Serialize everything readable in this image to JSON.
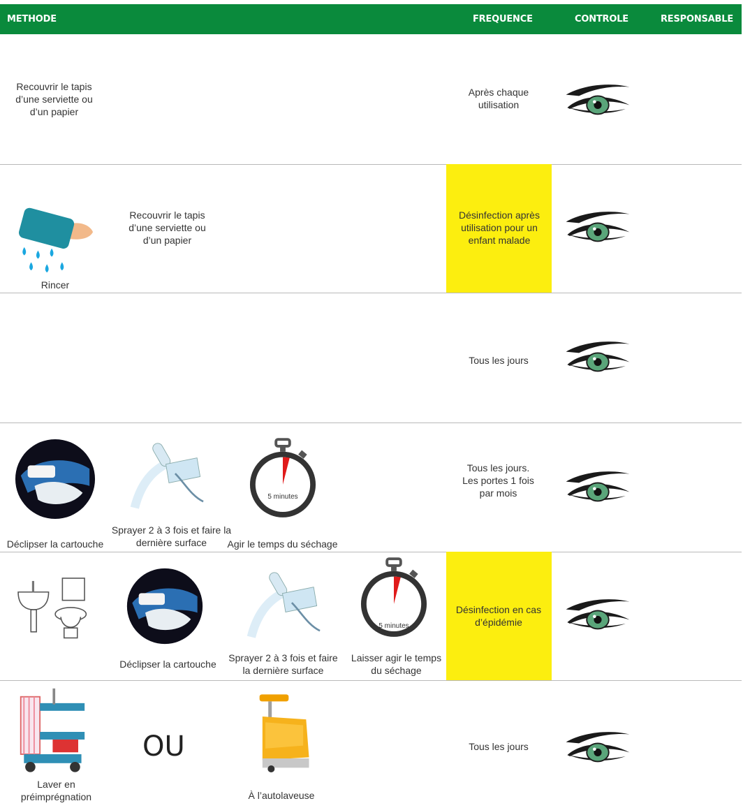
{
  "header": {
    "methode": "METHODE",
    "frequence": "FREQUENCE",
    "controle": "CONTROLE",
    "responsable": "RESPONSABLE"
  },
  "colors": {
    "header_bg": "#0a8a3c",
    "highlight": "#fcee0f",
    "divider": "#b9b9b9"
  },
  "rows": [
    {
      "methode": [
        "Recouvrir le tapis d’une serviette ou d’un papier"
      ],
      "frequence": "Après chaque utilisation",
      "highlight": false
    },
    {
      "methode": [
        "Rincer",
        "Recouvrir le tapis d’une serviette ou d’un papier"
      ],
      "frequence": "Désinfection après utilisation pour un enfant malade",
      "highlight": true
    },
    {
      "methode": [],
      "frequence": "Tous les jours",
      "highlight": false
    },
    {
      "methode": [
        "Déclipser la cartouche",
        "Sprayer 2 à 3 fois et faire la dernière surface",
        "Agir le temps du séchage"
      ],
      "timer": "5 minutes",
      "frequence": "Tous les jours. Les portes 1 fois par mois",
      "highlight": false
    },
    {
      "methode": [
        "Déclipser la cartouche",
        "Sprayer 2 à 3 fois et faire la dernière surface",
        "Laisser agir le temps du séchage"
      ],
      "timer": "5 minutes",
      "frequence": "Désinfection en cas d’épidémie",
      "highlight": true
    },
    {
      "methode": [
        "Laver en préimprégnation",
        "OU",
        "À l’autolaveuse"
      ],
      "frequence": "Tous les jours",
      "highlight": false
    }
  ],
  "icons": {
    "controle": "eye-icon",
    "rincer": "wet-cloth-icon",
    "declipser": "cartridge-hands-icon",
    "spray": "spray-icon",
    "timer": "stopwatch-icon",
    "sanitary": "toilet-sink-icon",
    "cart": "cleaning-cart-icon",
    "autolaveuse": "floor-scrubber-icon"
  }
}
